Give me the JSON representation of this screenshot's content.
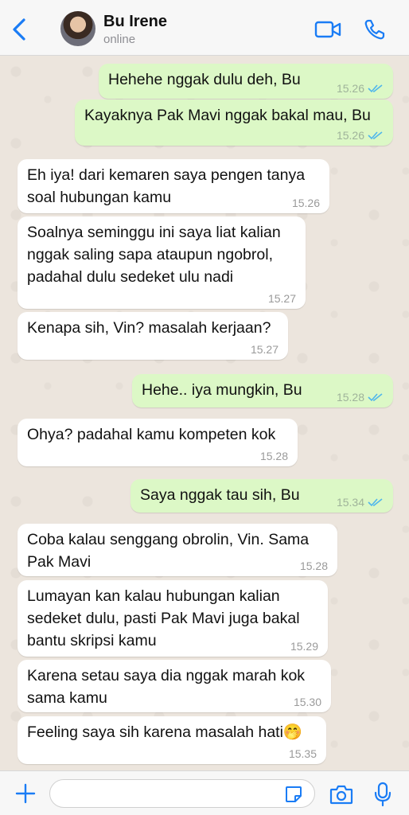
{
  "header": {
    "contact_name": "Bu Irene",
    "status": "online",
    "icons": [
      "back-icon",
      "avatar",
      "video-call-icon",
      "voice-call-icon"
    ]
  },
  "messages": [
    {
      "dir": "out",
      "text": "Hehehe nggak dulu deh, Bu",
      "time": "15.26",
      "read": true
    },
    {
      "dir": "out",
      "text": "Kayaknya Pak Mavi nggak bakal mau, Bu",
      "time": "15.26",
      "read": true
    },
    {
      "dir": "in",
      "text": "Eh iya! dari kemaren saya pengen tanya\nsoal hubungan kamu",
      "time": "15.26"
    },
    {
      "dir": "in",
      "text": "Soalnya seminggu ini saya liat kalian\nnggak saling sapa ataupun ngobrol,\npadahal dulu sedeket ulu nadi",
      "time": "15.27"
    },
    {
      "dir": "in",
      "text": "Kenapa sih, Vin? masalah kerjaan?",
      "time": "15.27"
    },
    {
      "dir": "out",
      "text": "Hehe.. iya mungkin, Bu",
      "time": "15.28",
      "read": true
    },
    {
      "dir": "in",
      "text": "Ohya? padahal kamu kompeten kok",
      "time": "15.28"
    },
    {
      "dir": "out",
      "text": "Saya nggak tau sih, Bu",
      "time": "15.34",
      "read": true
    },
    {
      "dir": "in",
      "text": "Coba kalau senggang obrolin, Vin. Sama\nPak Mavi",
      "time": "15.28"
    },
    {
      "dir": "in",
      "text": "Lumayan kan kalau hubungan kalian\nsedeket dulu, pasti Pak Mavi juga bakal\nbantu skripsi kamu",
      "time": "15.29"
    },
    {
      "dir": "in",
      "text": "Karena setau saya dia nggak marah kok\nsama kamu",
      "time": "15.30"
    },
    {
      "dir": "in",
      "text": "Feeling saya sih karena masalah hati🤭",
      "time": "15.35"
    }
  ],
  "colors": {
    "accent": "#1a7cf5",
    "outgoing_bubble": "#dcf8c6",
    "incoming_bubble": "#ffffff",
    "read_ticks": "#4fb6ec"
  },
  "composer": {
    "input_value": "",
    "icons": [
      "plus-icon",
      "sticker-icon",
      "camera-icon",
      "mic-icon"
    ]
  }
}
